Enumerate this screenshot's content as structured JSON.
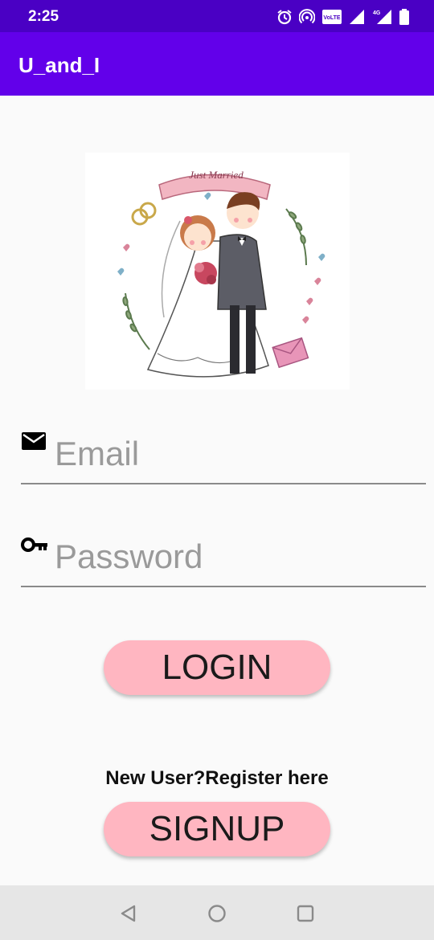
{
  "status_bar": {
    "time": "2:25",
    "icons": [
      "alarm-icon",
      "hotspot-icon",
      "volte-icon",
      "signal-icon",
      "4g-signal-icon",
      "battery-icon"
    ],
    "volte_text": "VoLTE"
  },
  "app_bar": {
    "title": "U_and_I"
  },
  "illustration": {
    "banner_text": "Just Married",
    "icon": "wedding-couple-illustration"
  },
  "form": {
    "email": {
      "placeholder": "Email",
      "value": "",
      "icon": "email-icon"
    },
    "password": {
      "placeholder": "Password",
      "value": "",
      "icon": "key-icon"
    }
  },
  "buttons": {
    "login_label": "LOGIN",
    "signup_label": "SIGNUP"
  },
  "register_prompt": "New User?Register here",
  "nav_bar": {
    "icons": [
      "back-icon",
      "home-icon",
      "recents-icon"
    ]
  },
  "colors": {
    "status_bar": "#4a00c4",
    "app_bar": "#6200ea",
    "button": "#ffb6c1",
    "background": "#fafafa"
  }
}
